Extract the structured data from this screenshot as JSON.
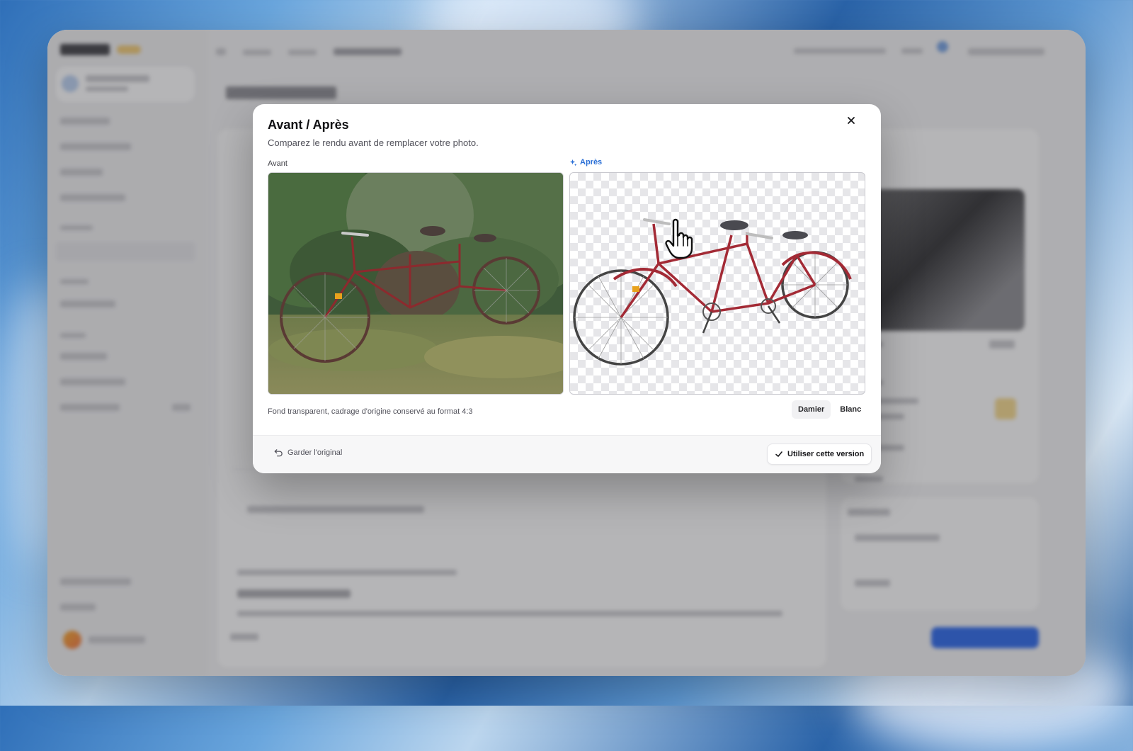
{
  "modal": {
    "title": "Avant / Après",
    "subtitle": "Comparez le rendu avant de remplacer votre photo.",
    "before_label": "Avant",
    "after_label": "Après",
    "caption": "Fond transparent, cadrage d'origine conservé au format 4:3",
    "background_options": [
      "Damier",
      "Blanc"
    ],
    "selected_background": "Damier",
    "keep_original_label": "Garder l'original",
    "use_version_label": "Utiliser cette version",
    "after_label_color": "#2a6fd6"
  },
  "icons": {
    "close": "close-icon",
    "sparkle": "sparkle-icon",
    "undo": "undo-icon",
    "check": "check-icon",
    "cursor": "hand-pointer-icon"
  }
}
